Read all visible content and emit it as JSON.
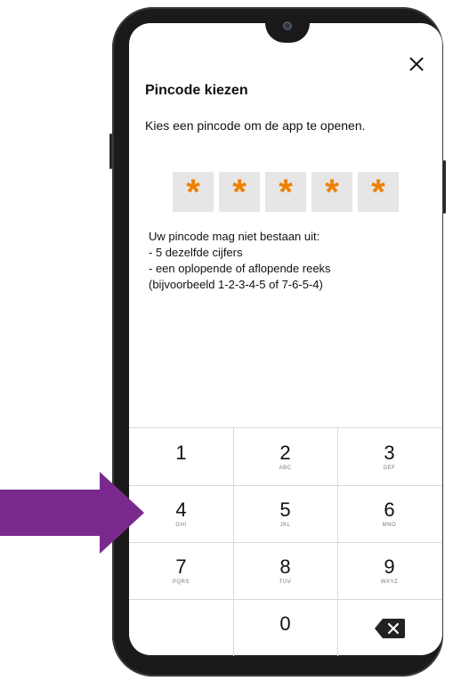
{
  "screen": {
    "title": "Pincode kiezen",
    "description": "Kies een pincode om de app te openen."
  },
  "pin": {
    "mask_char": "*",
    "digits_entered": 5,
    "mask_color": "#f07f00"
  },
  "rules": {
    "lines": [
      "Uw pincode mag niet bestaan uit:",
      "- 5 dezelfde cijfers",
      "- een oplopende of aflopende reeks",
      "(bijvoorbeeld 1-2-3-4-5 of 7-6-5-4)"
    ]
  },
  "keypad": {
    "keys": [
      {
        "num": "1",
        "letters": ""
      },
      {
        "num": "2",
        "letters": "ABC"
      },
      {
        "num": "3",
        "letters": "DEF"
      },
      {
        "num": "4",
        "letters": "GHI"
      },
      {
        "num": "5",
        "letters": "JKL"
      },
      {
        "num": "6",
        "letters": "MNO"
      },
      {
        "num": "7",
        "letters": "PQRS"
      },
      {
        "num": "8",
        "letters": "TUV"
      },
      {
        "num": "9",
        "letters": "WXYZ"
      },
      {
        "num": "0",
        "letters": ""
      }
    ]
  },
  "icons": {
    "close": "close-icon",
    "backspace": "backspace-icon",
    "arrow": "pointer-arrow-icon"
  },
  "colors": {
    "arrow": "#7a2a8f",
    "phone_frame": "#1a1a1a"
  }
}
